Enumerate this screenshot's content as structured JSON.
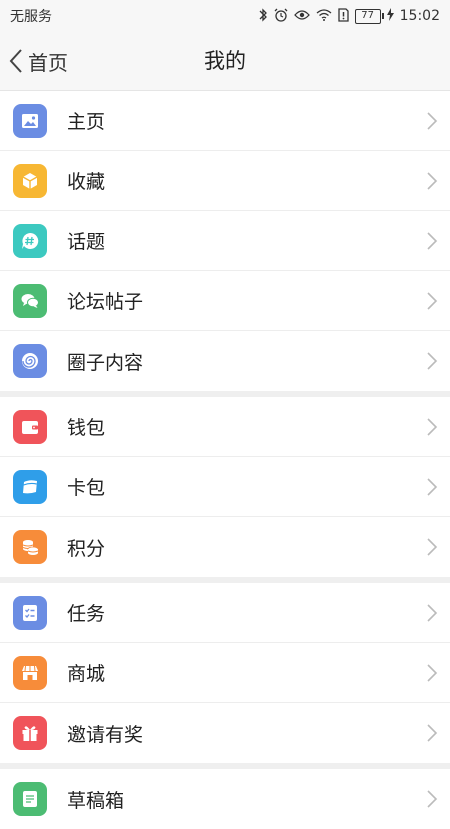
{
  "status_bar": {
    "carrier": "无服务",
    "battery": "77",
    "time": "15:02"
  },
  "header": {
    "back_label": "首页",
    "title": "我的"
  },
  "sections": [
    {
      "items": [
        {
          "label": "主页",
          "icon": "image-icon",
          "color": "#6b8de3"
        },
        {
          "label": "收藏",
          "icon": "box-icon",
          "color": "#f7b733"
        },
        {
          "label": "话题",
          "icon": "hashtag-chat-icon",
          "color": "#3cc9c0"
        },
        {
          "label": "论坛帖子",
          "icon": "chat-bubbles-icon",
          "color": "#4cbc73"
        },
        {
          "label": "圈子内容",
          "icon": "swirl-icon",
          "color": "#6b8de3"
        }
      ]
    },
    {
      "items": [
        {
          "label": "钱包",
          "icon": "wallet-icon",
          "color": "#f0545a"
        },
        {
          "label": "卡包",
          "icon": "card-icon",
          "color": "#2f9ee9"
        },
        {
          "label": "积分",
          "icon": "coins-icon",
          "color": "#f78c3a"
        }
      ]
    },
    {
      "items": [
        {
          "label": "任务",
          "icon": "checklist-icon",
          "color": "#6b8de3"
        },
        {
          "label": "商城",
          "icon": "store-icon",
          "color": "#f78c3a"
        },
        {
          "label": "邀请有奖",
          "icon": "gift-icon",
          "color": "#f0545a"
        }
      ]
    },
    {
      "items": [
        {
          "label": "草稿箱",
          "icon": "draft-icon",
          "color": "#4cbc73"
        }
      ]
    }
  ]
}
